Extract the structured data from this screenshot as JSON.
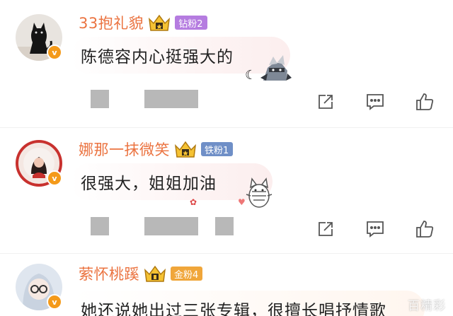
{
  "comments": [
    {
      "username": "33抱礼貌",
      "fan_badge": "钻粉2",
      "verified_badge": "v",
      "text": "陈德容内心挺强大的",
      "sticker": "cat-ninja-sticker"
    },
    {
      "username": "娜那一抹微笑",
      "fan_badge": "铁粉1",
      "verified_badge": "v",
      "text": "很强大，姐姐加油",
      "sticker": "cheering-cat-sticker"
    },
    {
      "username": "萦怀桃蹊",
      "fan_badge": "金粉4",
      "verified_badge": "v",
      "text": "她还说她出过三张专辑，很擅长唱抒情歌"
    }
  ],
  "actions": [
    "share-icon",
    "comment-icon",
    "like-icon"
  ],
  "watermark": "百精彩",
  "colors": {
    "username": "#eb7340",
    "verified": "#f49a1a",
    "diamond_badge": "#b57ce0",
    "iron_badge": "#6f8fc7",
    "gold_badge": "#f0a63a",
    "image_placeholder": "#b8b8b8"
  }
}
